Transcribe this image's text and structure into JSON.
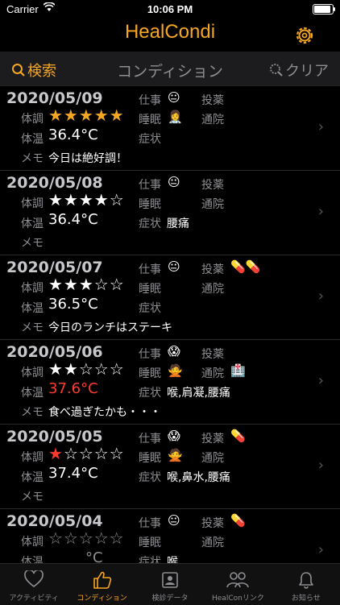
{
  "status": {
    "carrier": "Carrier",
    "time": "10:06 PM"
  },
  "app": {
    "title": "HealCondi",
    "accent": "#f5a623"
  },
  "toolbar": {
    "search_label": "検索",
    "title": "コンディション",
    "clear_label": "クリア"
  },
  "labels": {
    "taicho": "体調",
    "taion": "体温",
    "memo": "メモ",
    "shigoto": "仕事",
    "suimin": "睡眠",
    "shojo": "症状",
    "toyaku": "投薬",
    "tsuin": "通院"
  },
  "entries": [
    {
      "date": "2020/05/09",
      "stars": "★★★★★",
      "rating": 5,
      "temp": "36.4°C",
      "shigoto": "😐",
      "suimin": "👩‍⚕️",
      "toyaku": "",
      "tsuin": "",
      "symptoms": "",
      "memo": "今日は絶好調！"
    },
    {
      "date": "2020/05/08",
      "stars": "★★★★☆",
      "rating": 4,
      "temp": "36.4°C",
      "shigoto": "😐",
      "suimin": "",
      "toyaku": "",
      "tsuin": "",
      "symptoms": "腰痛",
      "memo": ""
    },
    {
      "date": "2020/05/07",
      "stars": "★★★☆☆",
      "rating": 3,
      "temp": "36.5°C",
      "shigoto": "😐",
      "suimin": "",
      "toyaku": "💊💊",
      "tsuin": "",
      "symptoms": "",
      "memo": "今日のランチはステーキ"
    },
    {
      "date": "2020/05/06",
      "stars": "★★☆☆☆",
      "rating": 2,
      "temp": "37.6°C",
      "shigoto": "😱",
      "suimin": "🙅",
      "toyaku": "",
      "tsuin": "🏥",
      "symptoms": "喉,肩凝,腰痛",
      "memo": "食べ過ぎたかも・・・"
    },
    {
      "date": "2020/05/05",
      "stars": "★☆☆☆☆",
      "rating": 1,
      "temp": "37.4°C",
      "shigoto": "😱",
      "suimin": "🙅",
      "toyaku": "💊",
      "tsuin": "",
      "symptoms": "喉,鼻水,腰痛",
      "memo": ""
    },
    {
      "date": "2020/05/04",
      "stars": "☆☆☆☆☆",
      "rating": 0,
      "temp": "°C",
      "shigoto": "😐",
      "suimin": "",
      "toyaku": "💊",
      "tsuin": "",
      "symptoms": "喉",
      "memo": ""
    }
  ],
  "tabs": [
    {
      "label": "アクティビティ",
      "icon": "heart-icon"
    },
    {
      "label": "コンディション",
      "icon": "thumbs-up-icon"
    },
    {
      "label": "検診データ",
      "icon": "id-card-icon"
    },
    {
      "label": "HealConリンク",
      "icon": "people-icon"
    },
    {
      "label": "お知らせ",
      "icon": "bell-icon"
    }
  ],
  "colors": {
    "background": "#000000",
    "accent": "#f5a623",
    "fever": "#ff3b30",
    "muted": "#8e8e93"
  }
}
